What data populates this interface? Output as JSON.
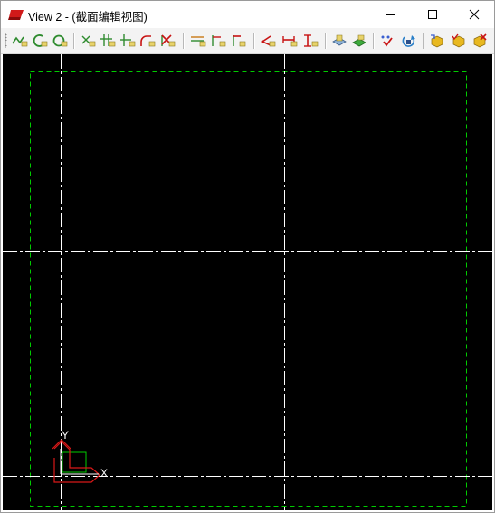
{
  "window": {
    "title": "View 2 - (截面编辑视图)",
    "controls": {
      "minimize": "minimize-icon",
      "maximize": "maximize-icon",
      "close": "close-icon"
    }
  },
  "toolbar": {
    "buttons": [
      "polyline-tool-icon",
      "arc-tool-icon",
      "circle-tool-icon",
      "point-tool-icon",
      "snap-intersection-icon",
      "snap-endpoint-icon",
      "fillet-tool-icon",
      "trim-tool-icon",
      "horizontal-constraint-icon",
      "parallel-constraint-icon",
      "perpendicular-constraint-icon",
      "dimension-angle-icon",
      "dimension-horizontal-icon",
      "dimension-vertical-icon",
      "extrude-view-icon",
      "revolve-view-icon",
      "check-profile-icon",
      "rotate-view-icon",
      "section-property-icon",
      "section-check-icon",
      "section-delete-icon"
    ]
  },
  "canvas": {
    "background": "#000000",
    "centerline_color": "#ffffff",
    "boundary_color": "#00cc00",
    "axis_labels": {
      "x": "X",
      "y": "Y"
    }
  }
}
